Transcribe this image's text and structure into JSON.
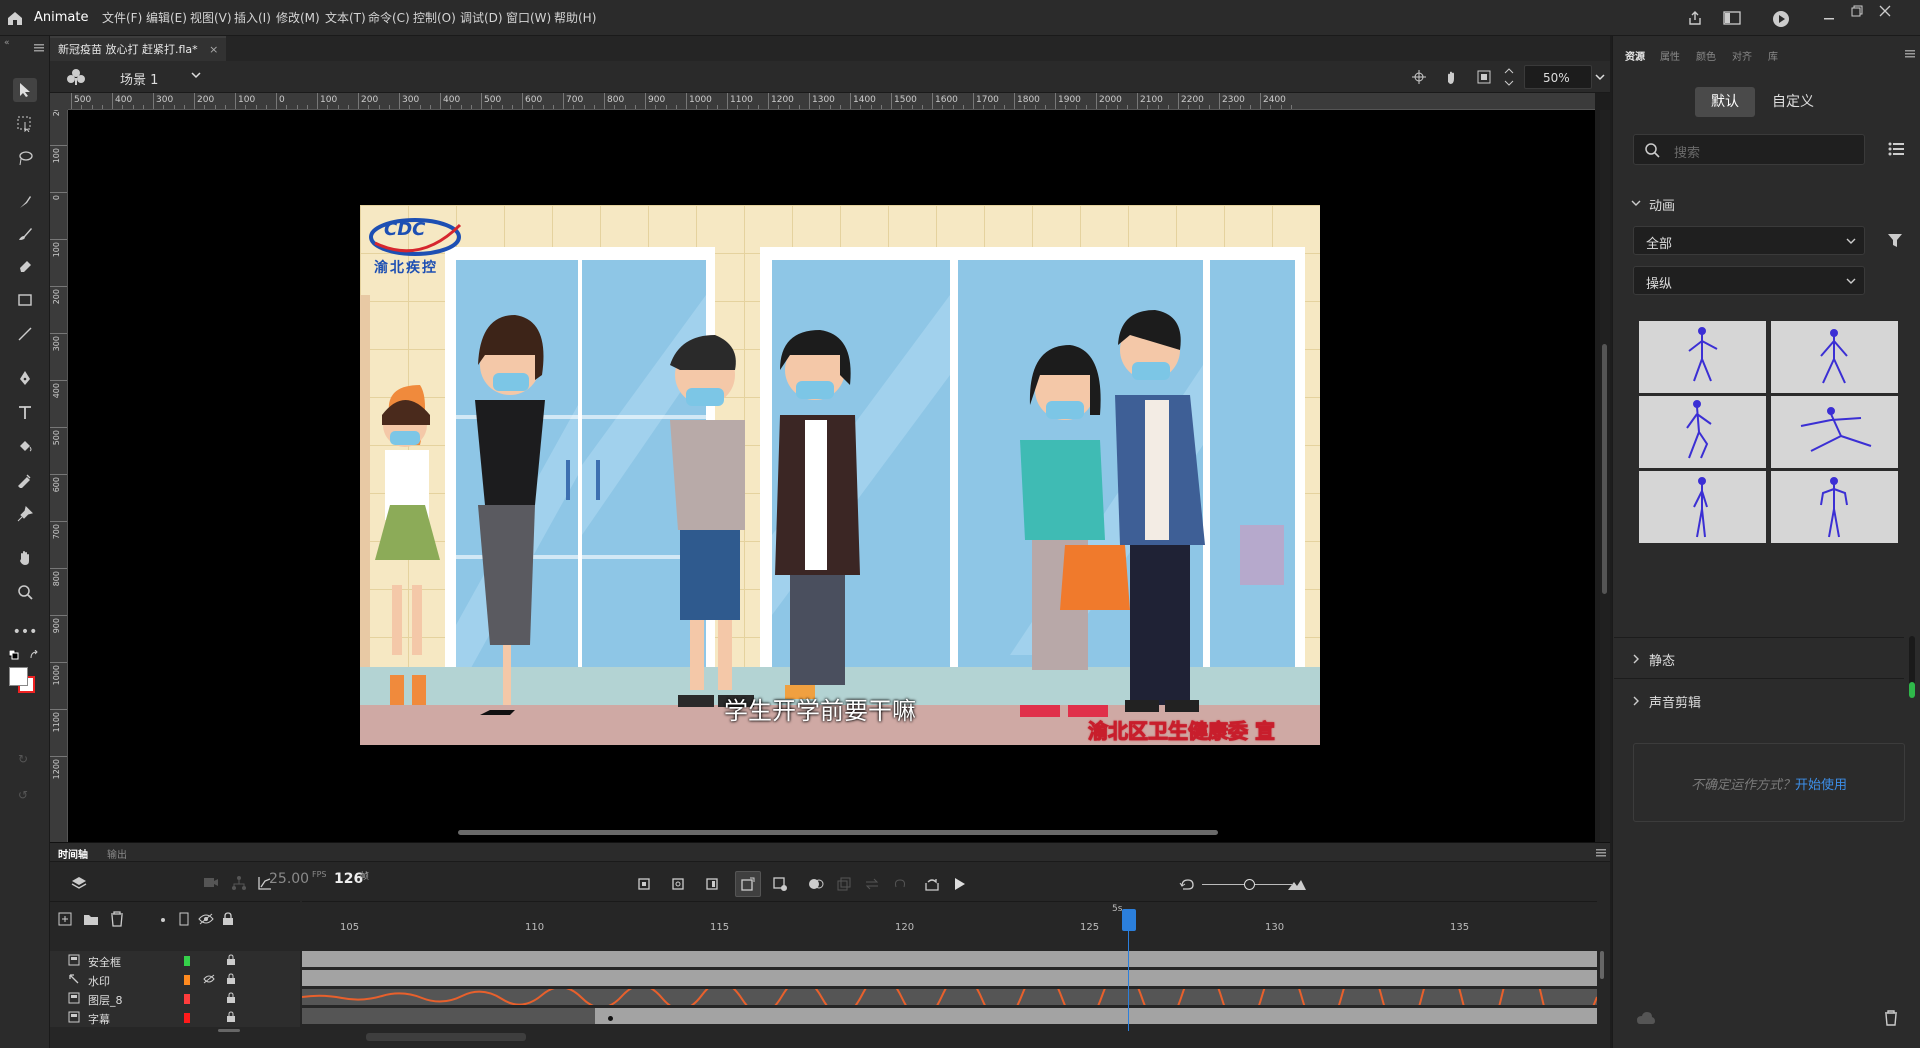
{
  "app": {
    "name": "Animate",
    "accent": "#2b7fdc"
  },
  "menu": [
    "文件(F)",
    "编辑(E)",
    "视图(V)",
    "插入(I)",
    "修改(M)",
    "文本(T)",
    "命令(C)",
    "控制(O)",
    "调试(D)",
    "窗口(W)",
    "帮助(H)"
  ],
  "document": {
    "tab_title": "新冠疫苗 放心打 赶紧打.fla*",
    "close": "×"
  },
  "scene": {
    "label": "场景 1",
    "zoom": "50%"
  },
  "ruler": {
    "h_labels": [
      "500",
      "400",
      "300",
      "200",
      "100",
      "0",
      "100",
      "200",
      "300",
      "400",
      "500",
      "600",
      "700",
      "800",
      "900",
      "1000",
      "1100",
      "1200",
      "1300",
      "1400",
      "1500",
      "1600",
      "1700",
      "1800",
      "1900",
      "2000",
      "2100",
      "2200",
      "2300",
      "2400"
    ],
    "v_labels": [
      "200",
      "100",
      "0",
      "100",
      "200",
      "300",
      "400",
      "500",
      "600",
      "700",
      "800",
      "900",
      "1000",
      "1100",
      "1200"
    ]
  },
  "stage_content": {
    "logo_text": "CDC",
    "logo_org": "渝北疾控",
    "subtitle": "学生开学前要干嘛",
    "credit": "渝北区卫生健康委 宣"
  },
  "right_panel": {
    "tabs": [
      "资源",
      "属性",
      "颜色",
      "对齐",
      "库"
    ],
    "toggle_default": "默认",
    "toggle_custom": "自定义",
    "search_placeholder": "搜索",
    "section_animation": "动画",
    "filter_all": "全部",
    "filter_puppet": "操纵",
    "section_static": "静态",
    "section_sound": "声音剪辑",
    "help_text": "不确定运作方式？",
    "help_link": "开始使用"
  },
  "timeline": {
    "tabs": [
      "时间轴",
      "输出"
    ],
    "fps": "25.00",
    "fps_unit": "FPS",
    "frame": "126",
    "frame_unit": "帧",
    "seconds_marker": "5s",
    "frame_numbers": [
      "105",
      "110",
      "115",
      "120",
      "125",
      "130",
      "135"
    ],
    "playhead_frame": 126,
    "layers": [
      {
        "name": "安全框",
        "color": "#35d14a",
        "hidden": false
      },
      {
        "name": "水印",
        "color": "#ff8a1f",
        "hidden": true
      },
      {
        "name": "图层_8",
        "color": "#ff3d3d",
        "hidden": false
      },
      {
        "name": "字幕",
        "color": "#ff1a1a",
        "hidden": false
      }
    ]
  }
}
